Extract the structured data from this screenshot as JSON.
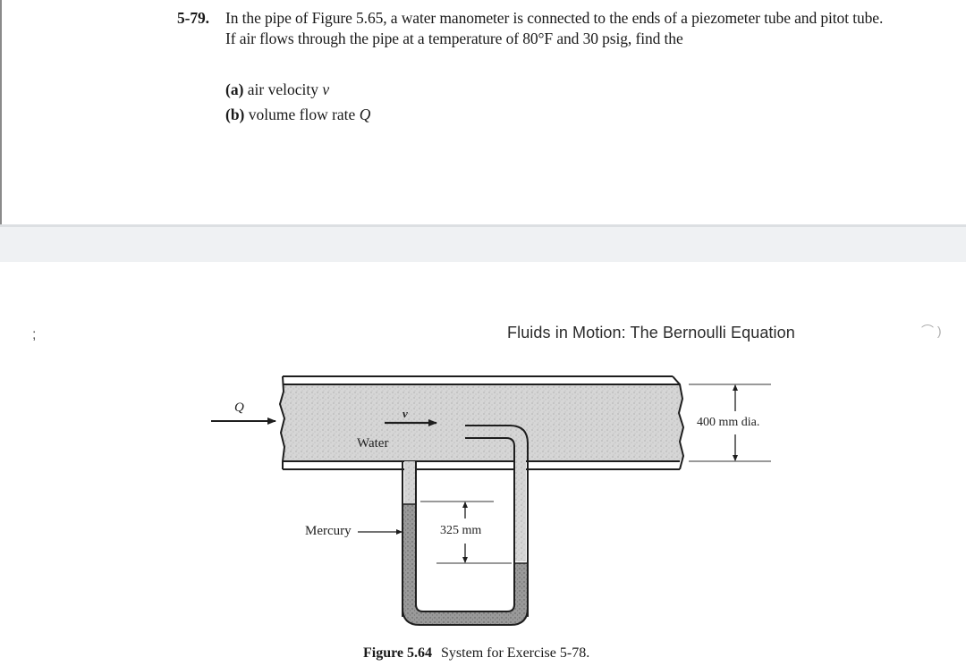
{
  "problem": {
    "number": "5-79.",
    "text": "In the pipe of Figure 5.65, a water manometer is connected to the ends of a piezometer tube and pitot tube. If air flows through the pipe at a temperature of 80°F and 30 psig, find the",
    "parts": [
      {
        "label": "(a)",
        "text": "air velocity",
        "symbol": "v"
      },
      {
        "label": "(b)",
        "text": "volume flow rate",
        "symbol": "Q"
      }
    ]
  },
  "page_header": {
    "title": "Fluids in Motion: The Bernoulli Equation"
  },
  "figure": {
    "labels": {
      "flow_rate": "Q",
      "velocity": "v",
      "fluid": "Water",
      "manometer_fluid": "Mercury",
      "deflection": "325 mm",
      "diameter": "400 mm dia."
    },
    "colors": {
      "fluid_fill": "#cfcfcf",
      "mercury_fill": "#8e8e8e",
      "outline": "#1e1e1e"
    },
    "caption_label": "Figure 5.64",
    "caption_text": "System for Exercise 5-78."
  },
  "marks": {
    "left": ";",
    "right": "⌒ )"
  }
}
